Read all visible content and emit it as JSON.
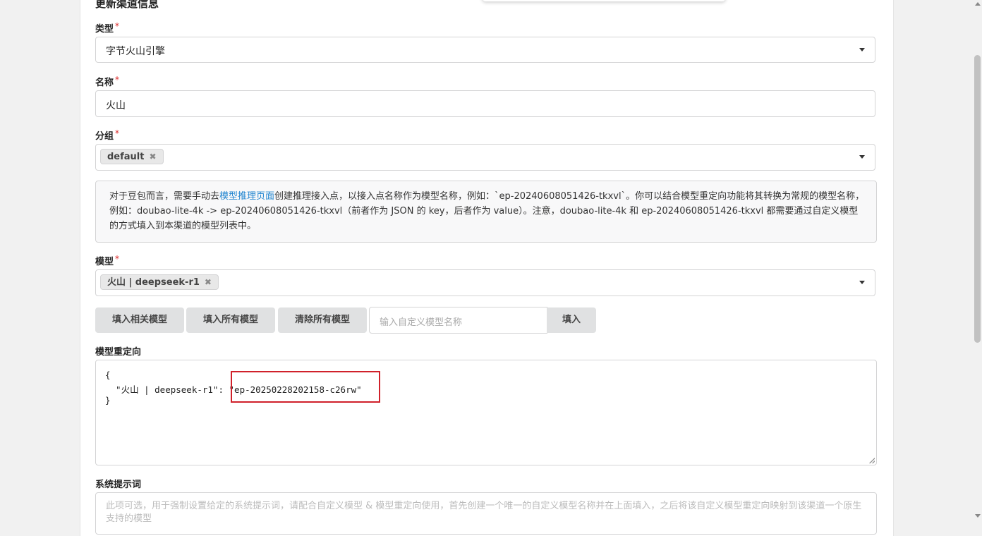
{
  "form": {
    "title": "更新渠道信息",
    "type": {
      "label": "类型",
      "value": "字节火山引擎"
    },
    "name": {
      "label": "名称",
      "value": "火山"
    },
    "group": {
      "label": "分组",
      "chip": "default"
    },
    "notice": {
      "before_link": "对于豆包而言，需要手动去",
      "link": "模型推理页面",
      "after_link": "创建推理接入点，以接入点名称作为模型名称，例如：`ep-20240608051426-tkxvl`。你可以结合模型重定向功能将其转换为常规的模型名称，例如：doubao-lite-4k -> ep-20240608051426-tkxvl（前者作为 JSON 的 key，后者作为 value）。注意，doubao-lite-4k 和 ep-20240608051426-tkxvl 都需要通过自定义模型的方式填入到本渠道的模型列表中。"
    },
    "models": {
      "label": "模型",
      "chip": "火山 | deepseek-r1"
    },
    "buttons": {
      "fill_related": "填入相关模型",
      "fill_all": "填入所有模型",
      "clear_all": "清除所有模型",
      "custom_placeholder": "输入自定义模型名称",
      "fill": "填入"
    },
    "mapping": {
      "label": "模型重定向",
      "line1": "{",
      "line2_key": "  \"火山 | deepseek-r1\": ",
      "line2_value": "\"ep-20250228202158-c26rw\"",
      "line3": "}"
    },
    "system_prompt": {
      "label": "系统提示词",
      "placeholder": "此项可选，用于强制设置给定的系统提示词，请配合自定义模型 & 模型重定向使用，首先创建一个唯一的自定义模型名称并在上面填入，之后将该自定义模型重定向映射到该渠道一个原生支持的模型"
    },
    "required_mark": "*",
    "chip_remove": "✖"
  }
}
